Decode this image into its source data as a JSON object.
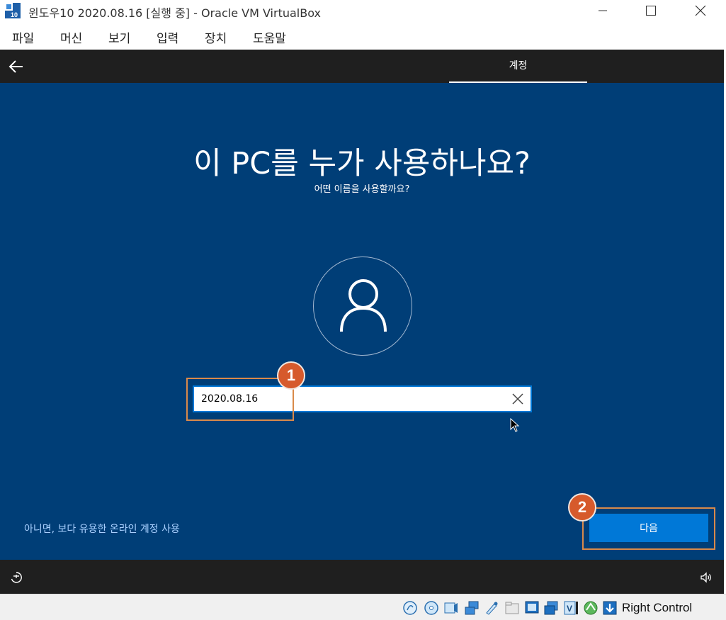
{
  "window": {
    "title": "윈도우10 2020.08.16 [실행 중] - Oracle VM VirtualBox",
    "app_icon_text": "10"
  },
  "menu": {
    "items": [
      "파일",
      "머신",
      "보기",
      "입력",
      "장치",
      "도움말"
    ]
  },
  "oobe": {
    "tab": "계정",
    "title": "이 PC를 누가 사용하나요?",
    "subtitle": "어떤 이름을 사용할까요?",
    "name_value": "2020.08.16",
    "online_link": "아니면, 보다 유용한 온라인 계정 사용",
    "next_label": "다음"
  },
  "annotations": {
    "badge_1": "1",
    "badge_2": "2",
    "color": "#d65a2c",
    "outline_color": "#d98a4a"
  },
  "statusbar": {
    "host_key": "Right Control",
    "icons": [
      "hard-disk-icon",
      "optical-drive-icon",
      "audio-icon",
      "network-icon",
      "usb-icon",
      "shared-folders-icon",
      "display-icon",
      "recording-icon",
      "vt-x-icon",
      "mouse-integration-icon",
      "guest-additions-icon"
    ]
  },
  "colors": {
    "oobe_background": "#003e77",
    "accent": "#0078d7",
    "dark_bar": "#1f1f1f"
  }
}
